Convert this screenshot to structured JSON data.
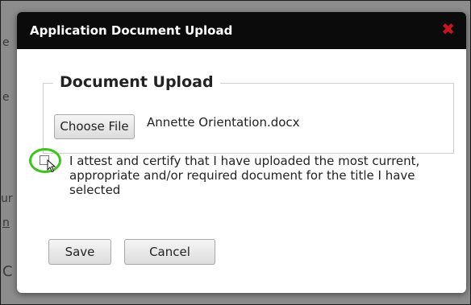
{
  "dialog": {
    "title": "Application Document Upload",
    "close_glyph": "✖"
  },
  "upload": {
    "legend": "Document Upload",
    "choose_file_label": "Choose File",
    "file_name": "Annette Orientation.docx"
  },
  "attestation": {
    "checked": false,
    "text": "I attest and certify that I have uploaded the most current, appropriate and/or required document for the title I have selected"
  },
  "actions": {
    "save_label": "Save",
    "cancel_label": "Cancel"
  },
  "background": {
    "glyphs": [
      "e",
      "e",
      "ur",
      "n",
      "C"
    ]
  },
  "colors": {
    "titlebar": "#0b0b0b",
    "close": "#c8161d",
    "highlight_ring": "#3cc51c",
    "overlay": "#8c8c8c"
  }
}
